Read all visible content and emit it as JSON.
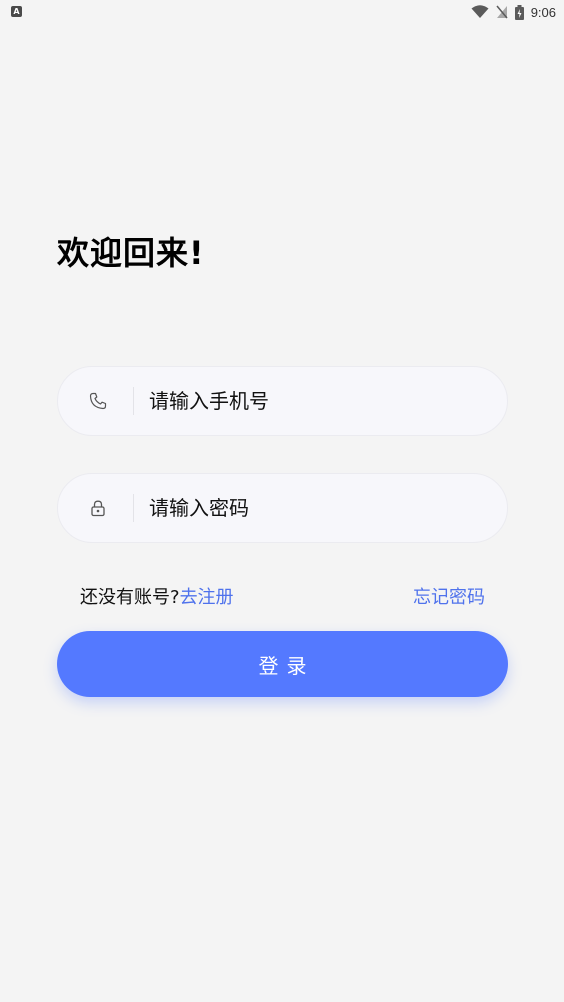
{
  "status_bar": {
    "time": "9:06",
    "left_icon": "a-icon",
    "wifi_icon": "wifi-icon",
    "signal_icon": "no-signal-icon",
    "battery_icon": "battery-charging-icon"
  },
  "welcome": {
    "title": "欢迎回来!"
  },
  "phone_field": {
    "placeholder": "请输入手机号",
    "value": "",
    "icon": "phone-icon"
  },
  "password_field": {
    "placeholder": "请输入密码",
    "value": "",
    "icon": "lock-icon"
  },
  "links": {
    "no_account_text": "还没有账号?",
    "register_label": "去注册",
    "forgot_password_label": "忘记密码"
  },
  "login": {
    "label": "登录"
  },
  "colors": {
    "accent": "#5479ff",
    "link": "#4f72ec",
    "background": "#f4f4f4",
    "field_background": "#f7f7fb"
  }
}
